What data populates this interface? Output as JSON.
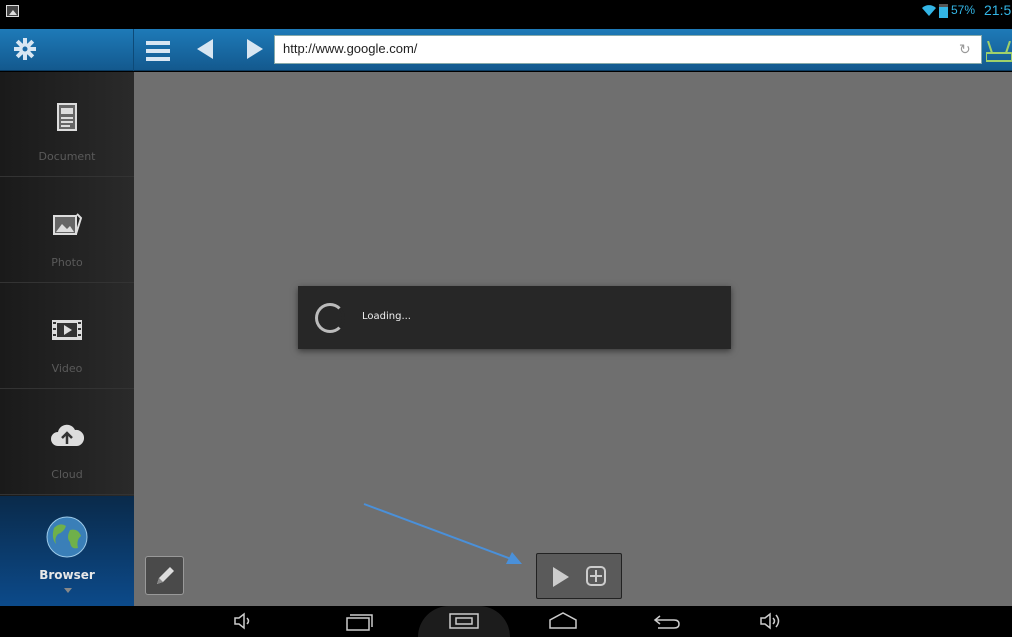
{
  "status_bar": {
    "battery_percent": "57%",
    "time": "21:5",
    "icons": [
      "picture-notification-icon",
      "wifi-icon",
      "battery-icon"
    ]
  },
  "toolbar": {
    "icons": [
      "settings-icon",
      "menu-icon",
      "back-icon",
      "forward-icon",
      "refresh-icon",
      "connect-icon"
    ],
    "url": "http://www.google.com/"
  },
  "sidebar": {
    "items": [
      {
        "label": "Document",
        "icon": "document-icon"
      },
      {
        "label": "Photo",
        "icon": "photo-icon"
      },
      {
        "label": "Video",
        "icon": "video-icon"
      },
      {
        "label": "Cloud",
        "icon": "cloud-icon"
      },
      {
        "label": "Browser",
        "icon": "globe-icon",
        "active": true
      }
    ]
  },
  "dialog": {
    "text": "Loading..."
  },
  "colors": {
    "toolbar": "#1a6aa6",
    "accent": "#33b5e5",
    "content_bg": "#6f6f6f",
    "annotation_arrow": "#4a90d9"
  }
}
